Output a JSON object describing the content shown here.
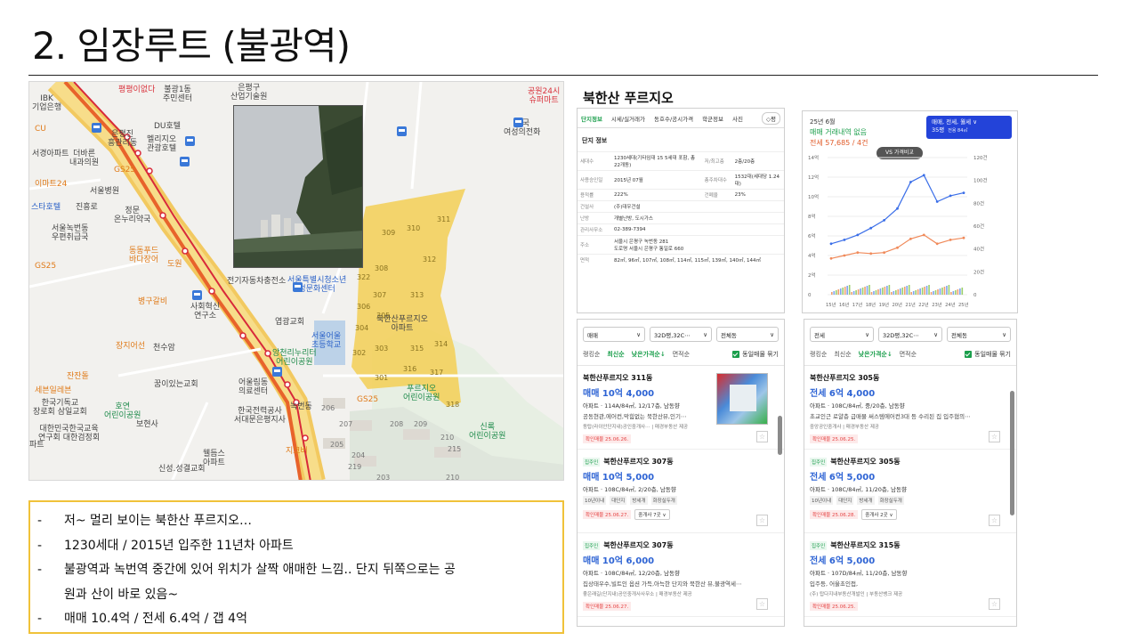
{
  "slide": {
    "title": "2. 임장루트 (불광역)"
  },
  "map": {
    "labels": [
      {
        "text": "IBK\n기업은행",
        "cls": ""
      },
      {
        "text": "서경아파트",
        "cls": ""
      },
      {
        "text": "CU",
        "cls": "orange"
      },
      {
        "text": "은평진\n흥관리동",
        "cls": ""
      },
      {
        "text": "더바른\n내과의원",
        "cls": ""
      },
      {
        "text": "DU호텔",
        "cls": ""
      },
      {
        "text": "멜리지오\n관광호텔",
        "cls": ""
      },
      {
        "text": "GS25",
        "cls": "orange"
      },
      {
        "text": "이마트24",
        "cls": "orange"
      },
      {
        "text": "서울병원",
        "cls": ""
      },
      {
        "text": "스타호텔",
        "cls": "blue"
      },
      {
        "text": "진흥로",
        "cls": ""
      },
      {
        "text": "정문\n온누리약국",
        "cls": ""
      },
      {
        "text": "서울녹번동\n우편취급국",
        "cls": ""
      },
      {
        "text": "동동푸드\n바다장어",
        "cls": "orange"
      },
      {
        "text": "도원",
        "cls": "orange"
      },
      {
        "text": "GS25",
        "cls": "orange"
      },
      {
        "text": "병구갈비",
        "cls": "orange"
      },
      {
        "text": "사회혁신\n연구소",
        "cls": ""
      },
      {
        "text": "천수암",
        "cls": ""
      },
      {
        "text": "장지어선",
        "cls": "orange"
      },
      {
        "text": "잔잔돌",
        "cls": "orange"
      },
      {
        "text": "세븐일레븐",
        "cls": "orange"
      },
      {
        "text": "한국기독교\n장로회 삼일교회",
        "cls": ""
      },
      {
        "text": "한국기독교\n장로회 삼일교회",
        "cls": ""
      },
      {
        "text": "대한민국한국교육\n연구회 대한검정회",
        "cls": ""
      },
      {
        "text": "꿈이있는교회",
        "cls": ""
      },
      {
        "text": "호연\n어린이공원",
        "cls": "green"
      },
      {
        "text": "보현사",
        "cls": ""
      },
      {
        "text": "신성.성결교회",
        "cls": ""
      },
      {
        "text": "웰듬스\n아파트",
        "cls": ""
      },
      {
        "text": "파트",
        "cls": ""
      },
      {
        "text": "불광1동\n주민센터",
        "cls": ""
      },
      {
        "text": "은평구\n산업기술원",
        "cls": ""
      },
      {
        "text": "한국전쟁",
        "cls": ""
      },
      {
        "text": "전기자동차충전소",
        "cls": ""
      },
      {
        "text": "서울특별시청소년\n성문화센터",
        "cls": "blue"
      },
      {
        "text": "엽광교회",
        "cls": ""
      },
      {
        "text": "서울어울\n초등학교",
        "cls": "blue"
      },
      {
        "text": "앙천리누리터\n어린이공원",
        "cls": "green"
      },
      {
        "text": "어울림동\n의료센터",
        "cls": ""
      },
      {
        "text": "한국전력공사\n서대문은평지사",
        "cls": ""
      },
      {
        "text": "녹번동",
        "cls": ""
      },
      {
        "text": "지코버",
        "cls": "orange"
      },
      {
        "text": "GS25",
        "cls": "orange"
      },
      {
        "text": "북한산푸르지오\n아파트",
        "cls": ""
      },
      {
        "text": "푸르지오\n어린이공원",
        "cls": "green"
      },
      {
        "text": "신록\n어린이공원",
        "cls": "green"
      },
      {
        "text": "한국\n여성의전화",
        "cls": ""
      },
      {
        "text": "공원24시\n슈퍼마트",
        "cls": "red"
      },
      {
        "text": "평평이없다",
        "cls": "red"
      }
    ],
    "building_numbers": [
      "311",
      "309",
      "310",
      "308",
      "312",
      "322",
      "307",
      "313",
      "306",
      "305",
      "304",
      "303",
      "302",
      "301",
      "315",
      "316",
      "317",
      "314",
      "318",
      "206",
      "207",
      "205",
      "204",
      "203",
      "208",
      "209",
      "210",
      "215",
      "219",
      "210"
    ]
  },
  "notes": [
    {
      "dash": "-",
      "text": "저~ 멀리 보이는 북한산 푸르지오…"
    },
    {
      "dash": "-",
      "text": "1230세대 / 2015년 입주한 11년차 아파트"
    },
    {
      "dash": "-",
      "text": "불광역과 녹번역 중간에 있어 위치가 살짝 애매한 느낌..  단지 뒤쪽으로는 공"
    },
    {
      "dash": "",
      "text": "원과 산이 바로 있음~"
    },
    {
      "dash": "-",
      "text": "매매 10.4억 / 전세 6.4억 / 갭 4억"
    }
  ],
  "complex_name": "북한산 푸르지오",
  "info_panel": {
    "tabs": [
      "단지정보",
      "시세/실거래가",
      "동호수/공시가격",
      "학군정보",
      "사진"
    ],
    "tab_button": "◇평",
    "heading": "단지 정보",
    "rows": [
      {
        "k": "세대수",
        "v": "1230세대(기타임대 15 5세대 포함, 총22개동)",
        "k2": "저/최고층",
        "v2": "2층/20층"
      },
      {
        "k": "사용승인일",
        "v": "2015년 07월",
        "k2": "총주차대수",
        "v2": "1532대(세대당 1.24 대)"
      },
      {
        "k": "용적률",
        "v": "222%",
        "k2": "건폐율",
        "v2": "23%"
      },
      {
        "k": "건설사",
        "v": "(주)대우건설",
        "k2": "",
        "v2": ""
      },
      {
        "k": "난방",
        "v": "개별난방, 도시가스",
        "k2": "",
        "v2": ""
      },
      {
        "k": "관리사무소",
        "v": "02-389-7394",
        "k2": "",
        "v2": ""
      },
      {
        "k": "주소",
        "v": "서울시 은평구 녹번동 281\n도로명  서울시 은평구 통일로 660",
        "k2": "",
        "v2": ""
      },
      {
        "k": "면적",
        "v": "82㎡, 96㎡, 107㎡, 108㎡, 114㎡, 115㎡, 139㎡, 140㎡, 144㎡",
        "k2": "",
        "v2": ""
      }
    ]
  },
  "graph_panel": {
    "date": "25년 6월",
    "status": "매매 거래내역 없음",
    "price": "전세 57,685 / 4건",
    "chip_line1": "매매, 전세, 월세 ∨",
    "chip_line2": "35평",
    "chip_sub": "전용 84㎡",
    "vs": "VS 가격비교",
    "left_ticks": [
      "14억",
      "12억",
      "10억",
      "8억",
      "6억",
      "4억",
      "2억",
      "0"
    ],
    "right_ticks": [
      "120건",
      "100건",
      "80건",
      "60건",
      "40건",
      "20건",
      "0"
    ],
    "x_ticks": [
      "15년",
      "16년",
      "17년",
      "18년",
      "19년",
      "20년",
      "21년",
      "22년",
      "23년",
      "24년",
      "25년"
    ]
  },
  "chart_data": {
    "type": "line",
    "x": [
      "15년",
      "16년",
      "17년",
      "18년",
      "19년",
      "20년",
      "21년",
      "22년",
      "23년",
      "24년",
      "25년"
    ],
    "series": [
      {
        "name": "매매",
        "values": [
          5.2,
          5.6,
          6.1,
          6.8,
          7.6,
          8.8,
          11.5,
          12.2,
          9.5,
          10.1,
          10.4
        ]
      },
      {
        "name": "전세",
        "values": [
          3.7,
          4.0,
          4.3,
          4.2,
          4.3,
          4.8,
          5.7,
          6.1,
          5.2,
          5.6,
          5.8
        ]
      }
    ],
    "ylim": [
      0,
      14
    ],
    "y2lim": [
      0,
      120
    ],
    "colors": {
      "sale": "#3a6ee8",
      "lease": "#f08a5a"
    }
  },
  "list1": {
    "filters": [
      "매매",
      "32D평,32C⋯",
      "전체동"
    ],
    "sorts": [
      "랭킹순",
      "최신순",
      "낮은가격순↓",
      "면적순"
    ],
    "active_sort": "낮은가격순↓",
    "active_sort2": "최신순",
    "checkbox": "동일매물 묶기",
    "items": [
      {
        "badge": "",
        "title": "북한산푸르지오 311동",
        "price": "매매 10억 4,000",
        "spec": "아파트 · 114A/84㎡, 12/17층, 남동향",
        "desc": "공동현관,에어컨,막힘없는 북한산뷰,인기⋯",
        "tags": [],
        "agent": "동탑(라이안단지내)공인중개사⋯ | 매경부동산 제공",
        "date": "확인매물 25.06.26.",
        "broker": "",
        "thumb": true
      },
      {
        "badge": "집주인",
        "title": "북한산푸르지오 307동",
        "price": "매매 10억 5,000",
        "spec": "아파트 · 108C/84㎡, 2/20층, 남동향",
        "desc": "",
        "tags": [
          "10년이내",
          "대단지",
          "방세개",
          "화장실두개"
        ],
        "agent": "",
        "date": "확인매물 25.06.27.",
        "broker": "중개사 7곳 ∨",
        "thumb": false
      },
      {
        "badge": "집주인",
        "title": "북한산푸르지오 307동",
        "price": "매매 10억 6,000",
        "spec": "아파트 · 108C/84㎡, 12/20층, 남동향",
        "desc": "집상태우수,빌트인 옵션 가득,아늑한 단지와 북한산 뷰,불광역세⋯",
        "tags": [],
        "agent": "좋은래길(단지내)공인중개사사무소 | 매경부동산 제공",
        "date": "확인매물 25.06.27.",
        "broker": "",
        "thumb": false
      }
    ]
  },
  "list2": {
    "filters": [
      "전세",
      "32D평,32C⋯",
      "전체동"
    ],
    "sorts": [
      "랭킹순",
      "최신순",
      "낮은가격순↓",
      "면적순"
    ],
    "active_sort": "낮은가격순↓",
    "checkbox": "동일매물 묶기",
    "items": [
      {
        "badge": "",
        "title": "북한산푸르지오 305동",
        "price": "전세 6억 4,000",
        "spec": "아파트 · 108C/84㎡, 중/20층, 남동향",
        "desc": "초교인근 로얄층 급매물 써스템에어컨3대 등 수리된 집 입주협의⋯",
        "tags": [],
        "agent": "중앙공인중개사 | 매경부동산 제공",
        "date": "확인매물 25.06.25.",
        "broker": ""
      },
      {
        "badge": "집주인",
        "title": "북한산푸르지오 305동",
        "price": "전세 6억 5,000",
        "spec": "아파트 · 108C/84㎡, 11/20층, 남동향",
        "desc": "",
        "tags": [
          "10년이내",
          "대단지",
          "방세개",
          "화장실두개"
        ],
        "agent": "",
        "date": "확인매물 25.06.28.",
        "broker": "중개사 2곳 ∨"
      },
      {
        "badge": "집주인",
        "title": "북한산푸르지오 315동",
        "price": "전세 6억 5,000",
        "spec": "아파트 · 107D/84㎡, 11/20층, 남동향",
        "desc": "입주등, 어울초인접,",
        "tags": [],
        "agent": "(주) 탑다지내부동산개발인 | 부동산뱅크 제공",
        "date": "확인매물 25.06.25.",
        "broker": ""
      }
    ]
  }
}
